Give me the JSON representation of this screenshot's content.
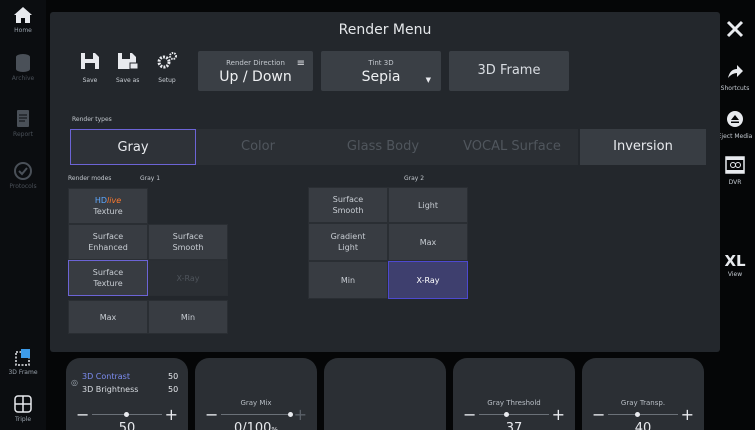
{
  "left_rail": [
    {
      "name": "home",
      "label": "Home",
      "icon": "home-icon"
    },
    {
      "name": "archive",
      "label": "Archive",
      "icon": "database-icon"
    },
    {
      "name": "report",
      "label": "Report",
      "icon": "report-icon"
    },
    {
      "name": "protocols",
      "label": "Protocols",
      "icon": "check-circle-icon"
    },
    {
      "name": "3d-frame",
      "label": "3D Frame",
      "icon": "3d-frame-icon"
    },
    {
      "name": "triple",
      "label": "Triple",
      "icon": "triple-icon"
    }
  ],
  "right_rail": [
    {
      "name": "close",
      "label": "",
      "icon": "close-icon"
    },
    {
      "name": "shortcuts",
      "label": "Shortcuts",
      "icon": "arrow-icon"
    },
    {
      "name": "eject",
      "label": "Eject Media",
      "icon": "eject-icon"
    },
    {
      "name": "dvr",
      "label": "DVR",
      "icon": "dvr-icon"
    },
    {
      "name": "view",
      "label": "View",
      "big": "XL"
    }
  ],
  "title": "Render Menu",
  "toolbar": {
    "save": "Save",
    "save_as": "Save as",
    "setup": "Setup"
  },
  "render_direction": {
    "label": "Render Direction",
    "value": "Up / Down"
  },
  "tint": {
    "label": "Tint 3D",
    "value": "Sepia"
  },
  "frame_button": "3D Frame",
  "render_types_label": "Render types",
  "render_types": [
    "Gray",
    "Color",
    "Glass Body",
    "VOCAL Surface",
    "Inversion"
  ],
  "render_modes_label": "Render modes",
  "gray1_label": "Gray 1",
  "gray2_label": "Gray 2",
  "gray1_modes": {
    "hdlive_h": "HD",
    "hdlive_l": "live",
    "hdlive_sub": "Texture",
    "surface_enhanced": "Surface\nEnhanced",
    "surface_smooth": "Surface\nSmooth",
    "surface_texture": "Surface\nTexture",
    "xray": "X-Ray",
    "max": "Max",
    "min": "Min"
  },
  "gray2_modes": {
    "surface_smooth": "Surface\nSmooth",
    "light": "Light",
    "gradient_light": "Gradient\nLight",
    "max": "Max",
    "min": "Min",
    "xray": "X-Ray"
  },
  "knobs": {
    "contrast_label": "3D Contrast",
    "contrast_value": "50",
    "brightness_label": "3D Brightness",
    "brightness_value": "50",
    "k1_value": "50",
    "gray_mix_label": "Gray Mix",
    "gray_mix_value": "0/100",
    "gray_mix_unit": "%",
    "gray_threshold_label": "Gray Threshold",
    "gray_threshold_value": "37",
    "gray_transp_label": "Gray Transp.",
    "gray_transp_value": "40"
  },
  "colors": {
    "accent": "#6c64d6",
    "panel": "#23272c",
    "button": "#3a3f45"
  }
}
